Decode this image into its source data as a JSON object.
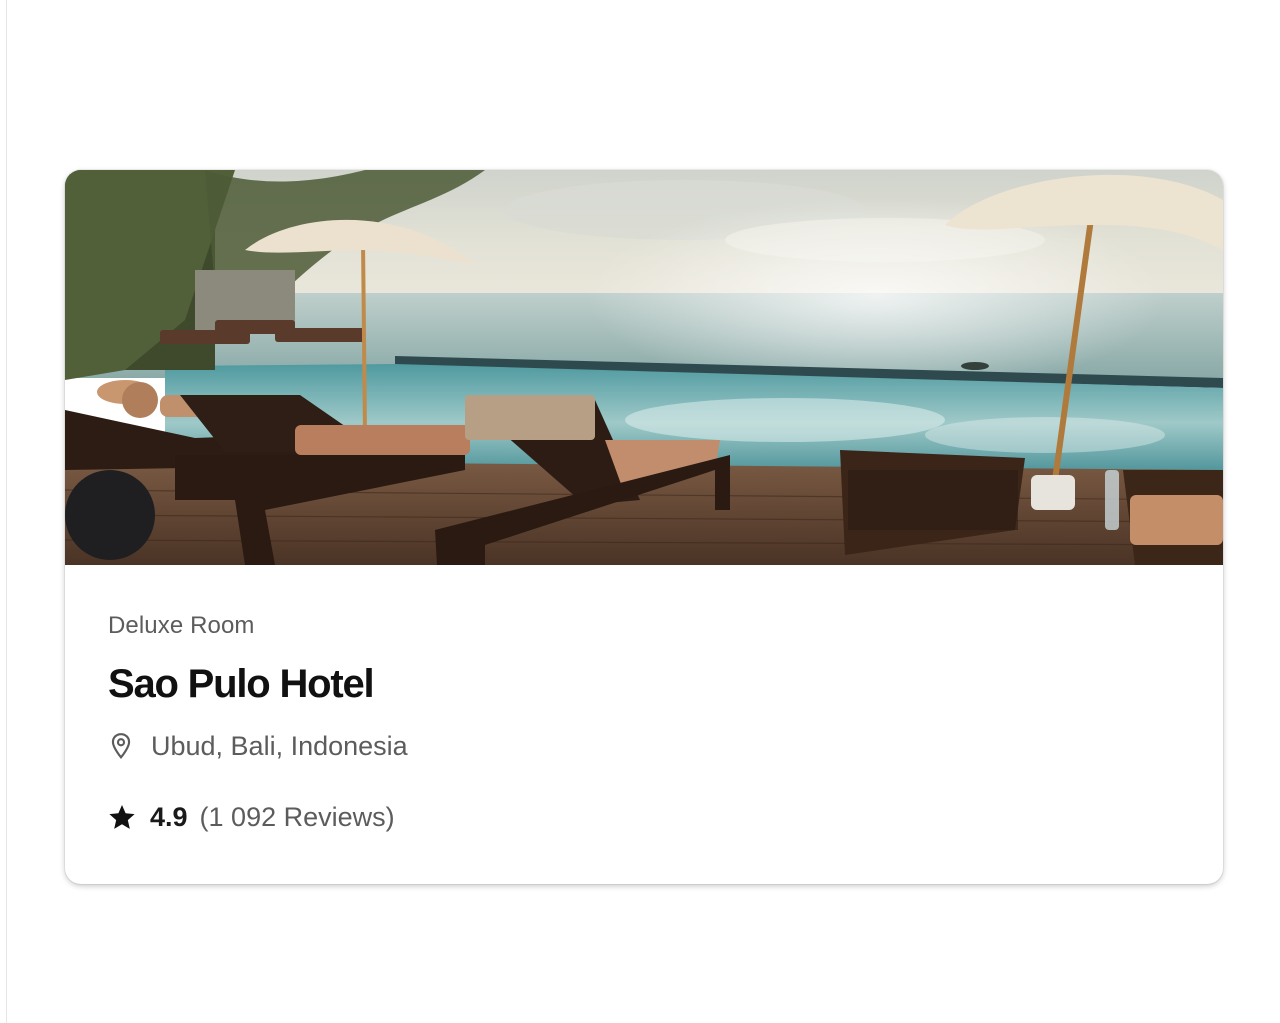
{
  "card": {
    "room_type": "Deluxe Room",
    "hotel_name": "Sao Pulo Hotel",
    "location": {
      "icon": "map-pin-icon",
      "text": "Ubud, Bali, Indonesia"
    },
    "rating": {
      "icon": "star-icon",
      "value": "4.9",
      "reviews": "(1 092 Reviews)"
    },
    "image": {
      "subject": "infinity-pool-sea-view"
    }
  },
  "colors": {
    "title": "#111111",
    "secondary_text": "#5c5c5c",
    "card_background": "#ffffff"
  }
}
